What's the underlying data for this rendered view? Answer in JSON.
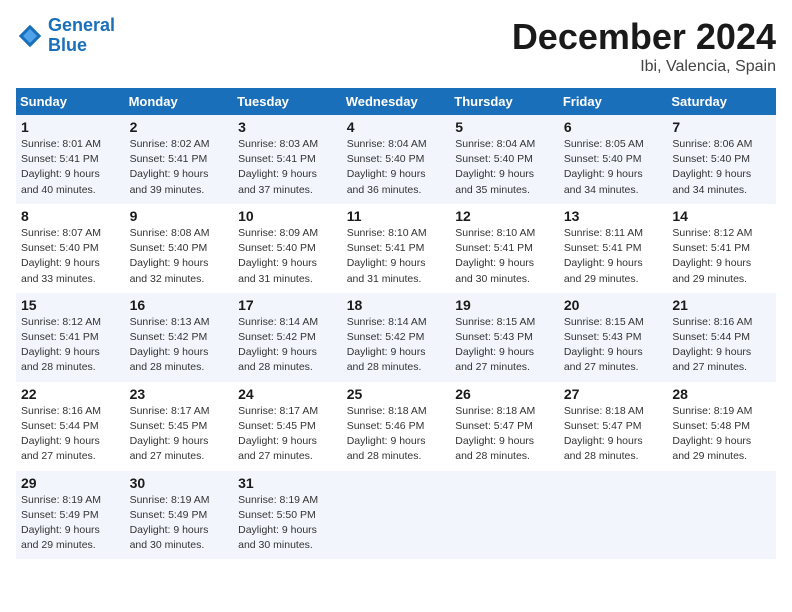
{
  "logo": {
    "line1": "General",
    "line2": "Blue"
  },
  "title": "December 2024",
  "location": "Ibi, Valencia, Spain",
  "days_of_week": [
    "Sunday",
    "Monday",
    "Tuesday",
    "Wednesday",
    "Thursday",
    "Friday",
    "Saturday"
  ],
  "weeks": [
    [
      {
        "num": "1",
        "sunrise": "8:01 AM",
        "sunset": "5:41 PM",
        "daylight": "9 hours and 40 minutes."
      },
      {
        "num": "2",
        "sunrise": "8:02 AM",
        "sunset": "5:41 PM",
        "daylight": "9 hours and 39 minutes."
      },
      {
        "num": "3",
        "sunrise": "8:03 AM",
        "sunset": "5:41 PM",
        "daylight": "9 hours and 37 minutes."
      },
      {
        "num": "4",
        "sunrise": "8:04 AM",
        "sunset": "5:40 PM",
        "daylight": "9 hours and 36 minutes."
      },
      {
        "num": "5",
        "sunrise": "8:04 AM",
        "sunset": "5:40 PM",
        "daylight": "9 hours and 35 minutes."
      },
      {
        "num": "6",
        "sunrise": "8:05 AM",
        "sunset": "5:40 PM",
        "daylight": "9 hours and 34 minutes."
      },
      {
        "num": "7",
        "sunrise": "8:06 AM",
        "sunset": "5:40 PM",
        "daylight": "9 hours and 34 minutes."
      }
    ],
    [
      {
        "num": "8",
        "sunrise": "8:07 AM",
        "sunset": "5:40 PM",
        "daylight": "9 hours and 33 minutes."
      },
      {
        "num": "9",
        "sunrise": "8:08 AM",
        "sunset": "5:40 PM",
        "daylight": "9 hours and 32 minutes."
      },
      {
        "num": "10",
        "sunrise": "8:09 AM",
        "sunset": "5:40 PM",
        "daylight": "9 hours and 31 minutes."
      },
      {
        "num": "11",
        "sunrise": "8:10 AM",
        "sunset": "5:41 PM",
        "daylight": "9 hours and 31 minutes."
      },
      {
        "num": "12",
        "sunrise": "8:10 AM",
        "sunset": "5:41 PM",
        "daylight": "9 hours and 30 minutes."
      },
      {
        "num": "13",
        "sunrise": "8:11 AM",
        "sunset": "5:41 PM",
        "daylight": "9 hours and 29 minutes."
      },
      {
        "num": "14",
        "sunrise": "8:12 AM",
        "sunset": "5:41 PM",
        "daylight": "9 hours and 29 minutes."
      }
    ],
    [
      {
        "num": "15",
        "sunrise": "8:12 AM",
        "sunset": "5:41 PM",
        "daylight": "9 hours and 28 minutes."
      },
      {
        "num": "16",
        "sunrise": "8:13 AM",
        "sunset": "5:42 PM",
        "daylight": "9 hours and 28 minutes."
      },
      {
        "num": "17",
        "sunrise": "8:14 AM",
        "sunset": "5:42 PM",
        "daylight": "9 hours and 28 minutes."
      },
      {
        "num": "18",
        "sunrise": "8:14 AM",
        "sunset": "5:42 PM",
        "daylight": "9 hours and 28 minutes."
      },
      {
        "num": "19",
        "sunrise": "8:15 AM",
        "sunset": "5:43 PM",
        "daylight": "9 hours and 27 minutes."
      },
      {
        "num": "20",
        "sunrise": "8:15 AM",
        "sunset": "5:43 PM",
        "daylight": "9 hours and 27 minutes."
      },
      {
        "num": "21",
        "sunrise": "8:16 AM",
        "sunset": "5:44 PM",
        "daylight": "9 hours and 27 minutes."
      }
    ],
    [
      {
        "num": "22",
        "sunrise": "8:16 AM",
        "sunset": "5:44 PM",
        "daylight": "9 hours and 27 minutes."
      },
      {
        "num": "23",
        "sunrise": "8:17 AM",
        "sunset": "5:45 PM",
        "daylight": "9 hours and 27 minutes."
      },
      {
        "num": "24",
        "sunrise": "8:17 AM",
        "sunset": "5:45 PM",
        "daylight": "9 hours and 27 minutes."
      },
      {
        "num": "25",
        "sunrise": "8:18 AM",
        "sunset": "5:46 PM",
        "daylight": "9 hours and 28 minutes."
      },
      {
        "num": "26",
        "sunrise": "8:18 AM",
        "sunset": "5:47 PM",
        "daylight": "9 hours and 28 minutes."
      },
      {
        "num": "27",
        "sunrise": "8:18 AM",
        "sunset": "5:47 PM",
        "daylight": "9 hours and 28 minutes."
      },
      {
        "num": "28",
        "sunrise": "8:19 AM",
        "sunset": "5:48 PM",
        "daylight": "9 hours and 29 minutes."
      }
    ],
    [
      {
        "num": "29",
        "sunrise": "8:19 AM",
        "sunset": "5:49 PM",
        "daylight": "9 hours and 29 minutes."
      },
      {
        "num": "30",
        "sunrise": "8:19 AM",
        "sunset": "5:49 PM",
        "daylight": "9 hours and 30 minutes."
      },
      {
        "num": "31",
        "sunrise": "8:19 AM",
        "sunset": "5:50 PM",
        "daylight": "9 hours and 30 minutes."
      },
      null,
      null,
      null,
      null
    ]
  ],
  "labels": {
    "sunrise": "Sunrise:",
    "sunset": "Sunset:",
    "daylight": "Daylight:"
  }
}
